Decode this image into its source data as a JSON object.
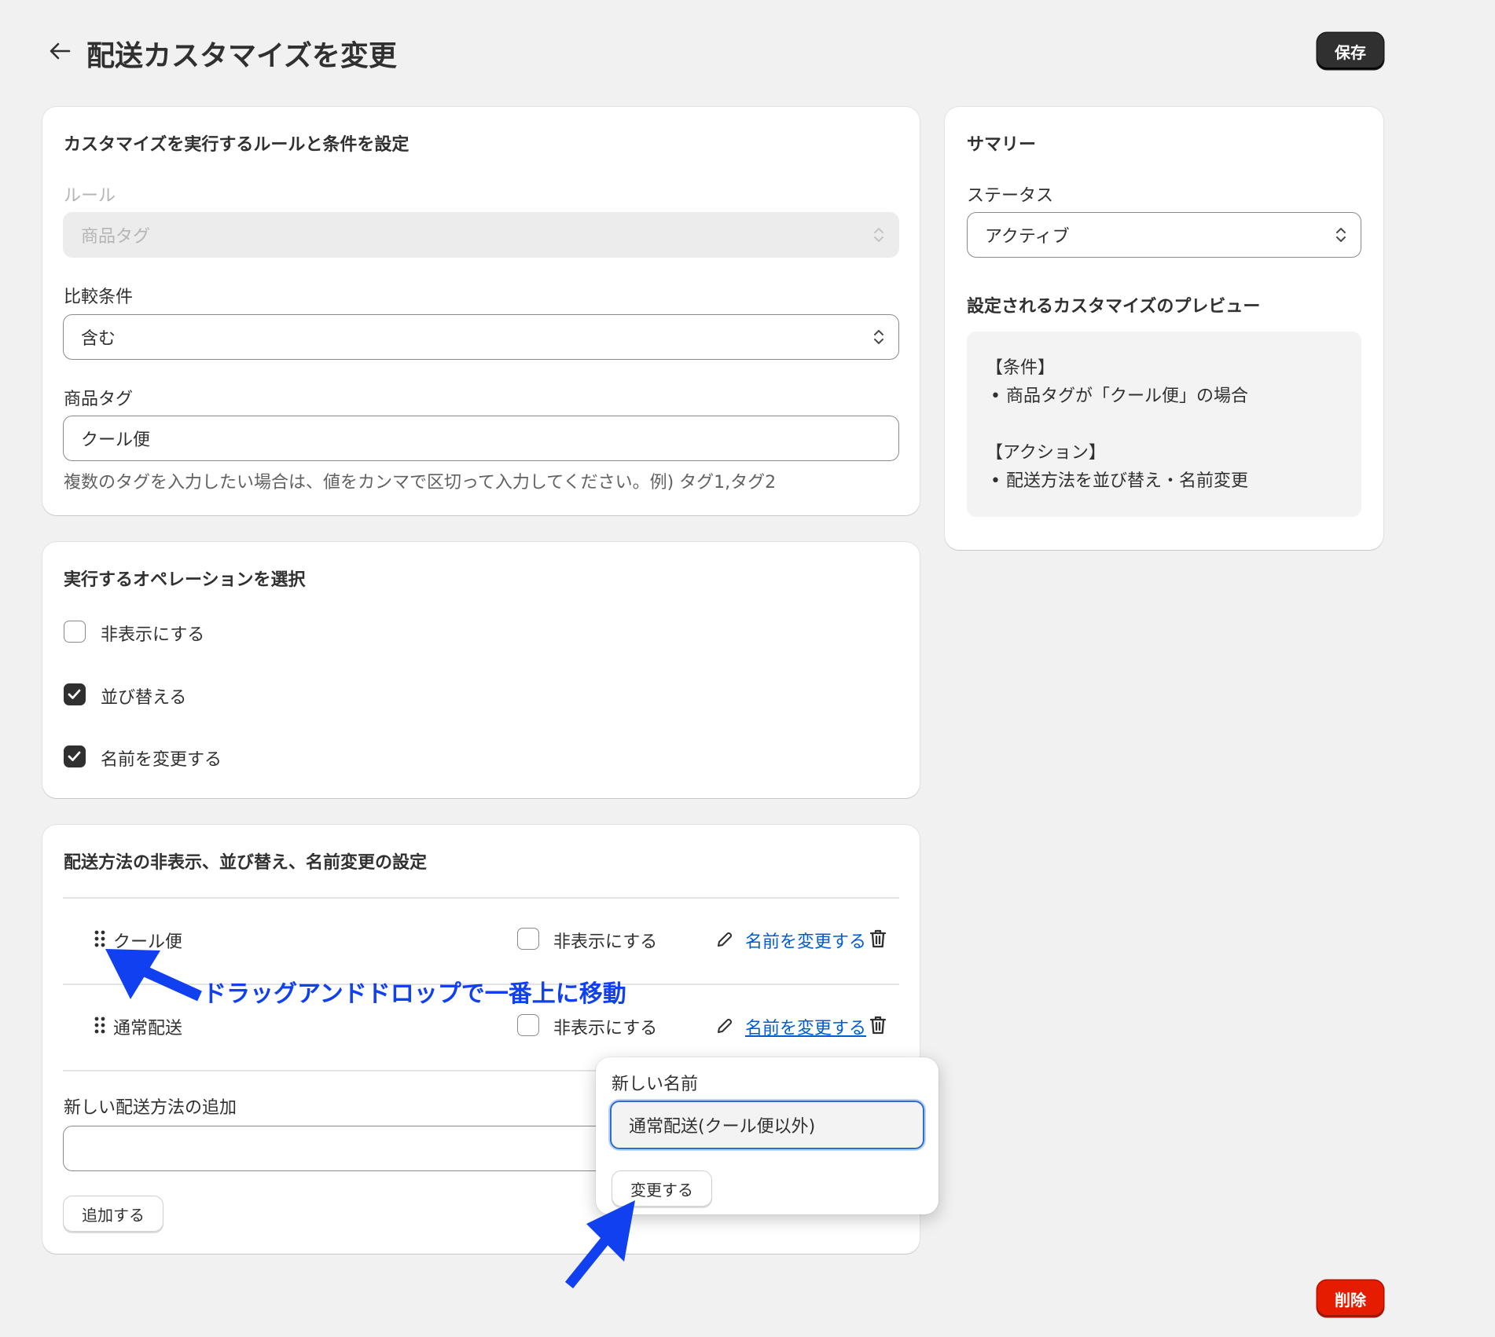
{
  "header": {
    "title": "配送カスタマイズを変更",
    "save_label": "保存",
    "back_icon": "arrow-left-icon"
  },
  "rules_card": {
    "title": "カスタマイズを実行するルールと条件を設定",
    "rule_label": "ルール",
    "rule_value": "商品タグ",
    "comparison_label": "比較条件",
    "comparison_value": "含む",
    "tag_label": "商品タグ",
    "tag_value": "クール便",
    "help_text": "複数のタグを入力したい場合は、値をカンマで区切って入力してください。例) タグ1,タグ2"
  },
  "operations_card": {
    "title": "実行するオペレーションを選択",
    "options": [
      {
        "label": "非表示にする",
        "checked": false
      },
      {
        "label": "並び替える",
        "checked": true
      },
      {
        "label": "名前を変更する",
        "checked": true
      }
    ]
  },
  "methods_card": {
    "title": "配送方法の非表示、並び替え、名前変更の設定",
    "rows": [
      {
        "name": "クール便",
        "hide_label": "非表示にする",
        "rename_label": "名前を変更する"
      },
      {
        "name": "通常配送",
        "hide_label": "非表示にする",
        "rename_label": "名前を変更する"
      }
    ],
    "add_label": "新しい配送方法の追加",
    "add_input_value": "",
    "add_button": "追加する"
  },
  "rename_popover": {
    "label": "新しい名前",
    "value": "通常配送(クール便以外)",
    "button": "変更する"
  },
  "summary_card": {
    "title": "サマリー",
    "status_label": "ステータス",
    "status_value": "アクティブ",
    "preview_label": "設定されるカスタマイズのプレビュー",
    "conditions_heading": "【条件】",
    "conditions_item": "• 商品タグが「クール便」の場合",
    "actions_heading": "【アクション】",
    "actions_item": "• 配送方法を並び替え・名前変更"
  },
  "annotation": {
    "text": "ドラッグアンドドロップで一番上に移動",
    "color": "#1040f0"
  },
  "footer": {
    "delete_label": "削除"
  },
  "colors": {
    "background": "#f1f1f1",
    "primary_button": "#303030",
    "danger_button": "#e51c00",
    "link": "#005bd3",
    "annotation": "#1040f0"
  }
}
